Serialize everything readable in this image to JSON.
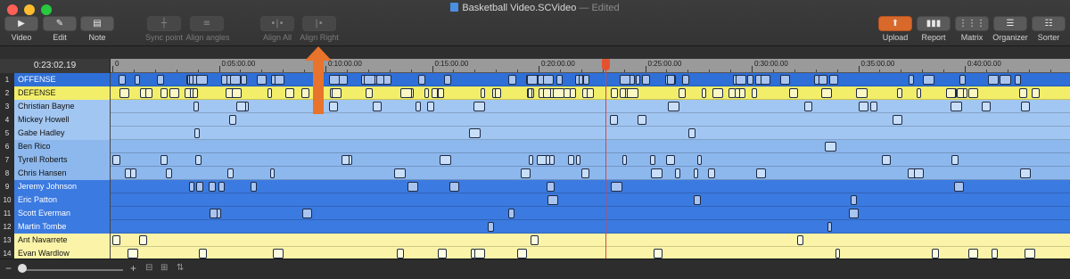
{
  "window": {
    "title": "Basketball Video.SCVideo",
    "edited": "— Edited"
  },
  "toolbar": {
    "left": [
      {
        "label": "Video",
        "icon": "video-icon",
        "dim": false
      },
      {
        "label": "Edit",
        "icon": "edit-icon",
        "dim": false
      },
      {
        "label": "Note",
        "icon": "note-icon",
        "dim": false
      }
    ],
    "middle": [
      {
        "label": "Sync point",
        "icon": "sync-point-icon",
        "dim": true
      },
      {
        "label": "Align angles",
        "icon": "align-angles-icon",
        "dim": true
      },
      {
        "label": "Align All",
        "icon": "align-all-icon",
        "dim": true
      },
      {
        "label": "Align Right",
        "icon": "align-right-icon",
        "dim": true
      }
    ],
    "right": [
      {
        "label": "Upload",
        "icon": "upload-icon"
      },
      {
        "label": "Report",
        "icon": "report-icon"
      },
      {
        "label": "Matrix",
        "icon": "matrix-icon"
      },
      {
        "label": "Organizer",
        "icon": "organizer-icon"
      },
      {
        "label": "Sorter",
        "icon": "sorter-icon"
      }
    ]
  },
  "timeline": {
    "timecode": "0:23:02.19",
    "ruler_labels": [
      "0",
      "0:05:00.00",
      "0:10:00.00",
      "0:15:00.00",
      "0:20:00.00",
      "0:25:00.00",
      "0:30:00.00",
      "0:35:00.00",
      "0:40:00.00"
    ],
    "rows": [
      {
        "number": "1",
        "name": "OFFENSE",
        "color": "#2e6fd8",
        "text": "#ffffff",
        "clip": "#a9c4ee"
      },
      {
        "number": "2",
        "name": "DEFENSE",
        "color": "#f2ee6a",
        "text": "#1a1a1a",
        "clip": "#fbf8c6"
      },
      {
        "number": "3",
        "name": "Christian Bayne",
        "color": "#a2c6f2",
        "text": "#111111",
        "clip": "#c9def8"
      },
      {
        "number": "4",
        "name": "Mickey Howell",
        "color": "#a2c6f2",
        "text": "#111111",
        "clip": "#c9def8"
      },
      {
        "number": "5",
        "name": "Gabe Hadley",
        "color": "#a2c6f2",
        "text": "#111111",
        "clip": "#c9def8"
      },
      {
        "number": "6",
        "name": "Ben Rico",
        "color": "#8db8ee",
        "text": "#111111",
        "clip": "#c9def8"
      },
      {
        "number": "7",
        "name": "Tyrell Roberts",
        "color": "#8db8ee",
        "text": "#111111",
        "clip": "#c9def8"
      },
      {
        "number": "8",
        "name": "Chris Hansen",
        "color": "#8db8ee",
        "text": "#111111",
        "clip": "#c9def8"
      },
      {
        "number": "9",
        "name": "Jeremy Johnson",
        "color": "#3b7ae0",
        "text": "#ffffff",
        "clip": "#a9c4ee"
      },
      {
        "number": "10",
        "name": "Eric Patton",
        "color": "#3b7ae0",
        "text": "#ffffff",
        "clip": "#a9c4ee"
      },
      {
        "number": "11",
        "name": "Scott Everman",
        "color": "#3b7ae0",
        "text": "#ffffff",
        "clip": "#a9c4ee"
      },
      {
        "number": "12",
        "name": "Martin Tombe",
        "color": "#3b7ae0",
        "text": "#ffffff",
        "clip": "#a9c4ee"
      },
      {
        "number": "13",
        "name": "Ant Navarrete",
        "color": "#fbf4a8",
        "text": "#111111",
        "clip": "#fdfbe0"
      },
      {
        "number": "14",
        "name": "Evan Wardlow",
        "color": "#fbf4a8",
        "text": "#111111",
        "clip": "#fdfbe0"
      }
    ]
  },
  "colors": {
    "accent": "#d8692a",
    "playhead": "#e04040"
  }
}
